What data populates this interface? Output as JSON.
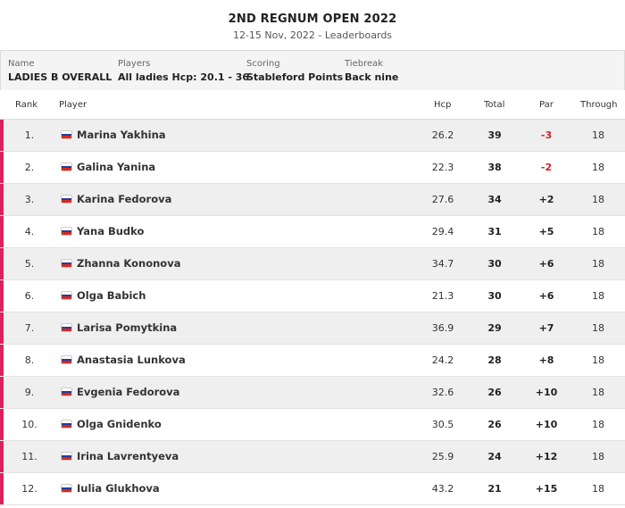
{
  "header": {
    "title": "2ND REGNUM OPEN 2022",
    "subtitle": "12-15 Nov, 2022 - Leaderboards"
  },
  "info": [
    {
      "label": "Name",
      "value": "LADIES B OVERALL"
    },
    {
      "label": "Players",
      "value": "All ladies Hcp: 20.1 - 36"
    },
    {
      "label": "Scoring",
      "value": "Stableford Points"
    },
    {
      "label": "Tiebreak",
      "value": "Back nine"
    }
  ],
  "columns": {
    "rank": "Rank",
    "player": "Player",
    "hcp": "Hcp",
    "total": "Total",
    "par": "Par",
    "through": "Through"
  },
  "colors": {
    "accent_bar": "#d9235a",
    "under_par": "#d0202e",
    "over_par": "#222222"
  },
  "flag_icon": "russia-flag-icon",
  "rows": [
    {
      "rank": "1.",
      "player": "Marina Yakhina",
      "hcp": "26.2",
      "total": "39",
      "par": "-3",
      "through": "18"
    },
    {
      "rank": "2.",
      "player": "Galina Yanina",
      "hcp": "22.3",
      "total": "38",
      "par": "-2",
      "through": "18"
    },
    {
      "rank": "3.",
      "player": "Karina Fedorova",
      "hcp": "27.6",
      "total": "34",
      "par": "+2",
      "through": "18"
    },
    {
      "rank": "4.",
      "player": "Yana Budko",
      "hcp": "29.4",
      "total": "31",
      "par": "+5",
      "through": "18"
    },
    {
      "rank": "5.",
      "player": "Zhanna Kononova",
      "hcp": "34.7",
      "total": "30",
      "par": "+6",
      "through": "18"
    },
    {
      "rank": "6.",
      "player": "Olga Babich",
      "hcp": "21.3",
      "total": "30",
      "par": "+6",
      "through": "18"
    },
    {
      "rank": "7.",
      "player": "Larisa Pomytkina",
      "hcp": "36.9",
      "total": "29",
      "par": "+7",
      "through": "18"
    },
    {
      "rank": "8.",
      "player": "Anastasia Lunkova",
      "hcp": "24.2",
      "total": "28",
      "par": "+8",
      "through": "18"
    },
    {
      "rank": "9.",
      "player": "Evgenia Fedorova",
      "hcp": "32.6",
      "total": "26",
      "par": "+10",
      "through": "18"
    },
    {
      "rank": "10.",
      "player": "Olga Gnidenko",
      "hcp": "30.5",
      "total": "26",
      "par": "+10",
      "through": "18"
    },
    {
      "rank": "11.",
      "player": "Irina Lavrentyeva",
      "hcp": "25.9",
      "total": "24",
      "par": "+12",
      "through": "18"
    },
    {
      "rank": "12.",
      "player": "Iulia Glukhova",
      "hcp": "43.2",
      "total": "21",
      "par": "+15",
      "through": "18"
    }
  ]
}
